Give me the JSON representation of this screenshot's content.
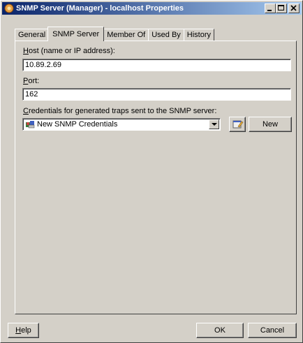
{
  "window": {
    "title": "SNMP Server (Manager) - localhost Properties",
    "controls": [
      "minimize",
      "maximize",
      "close"
    ]
  },
  "tabs": [
    {
      "label": "General",
      "active": false
    },
    {
      "label": "SNMP Server",
      "active": true
    },
    {
      "label": "Member Of",
      "active": false
    },
    {
      "label": "Used By",
      "active": false
    },
    {
      "label": "History",
      "active": false
    }
  ],
  "form": {
    "host": {
      "label_accel": "H",
      "label_rest": "ost (name or IP address):",
      "value": "10.89.2.69"
    },
    "port": {
      "label_accel": "P",
      "label_rest": "ort:",
      "value": "162"
    },
    "credentials": {
      "label_accel": "C",
      "label_rest": "redentials for generated traps sent to the SNMP server:",
      "selected": "New SNMP Credentials",
      "new_button": "New"
    }
  },
  "footer": {
    "help_accel": "H",
    "help_rest": "elp",
    "ok": "OK",
    "cancel": "Cancel"
  },
  "icons": {
    "app": "snmp-server-icon",
    "credentials": "credentials-icon",
    "edit": "properties-edit-icon"
  }
}
